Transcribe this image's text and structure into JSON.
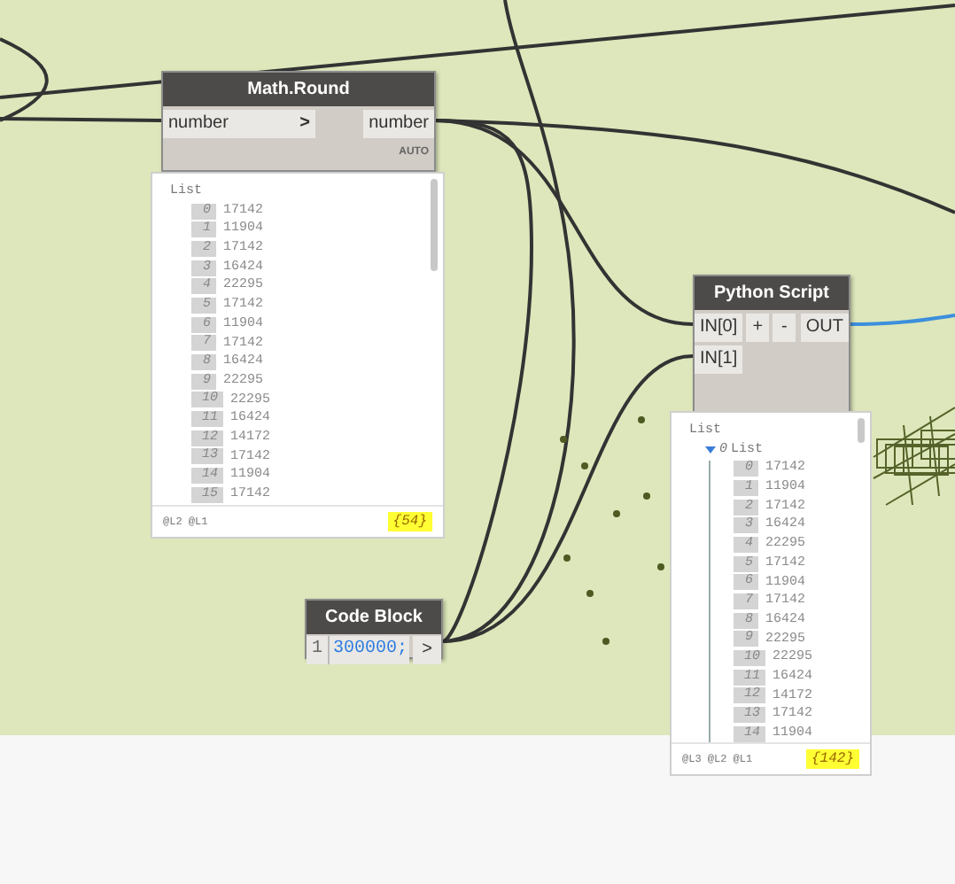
{
  "math_round": {
    "title": "Math.Round",
    "input": "number",
    "input_arrow": ">",
    "output": "number",
    "lacing": "AUTO",
    "preview": {
      "root": "List",
      "items": [
        {
          "index": "0",
          "value": "17142"
        },
        {
          "index": "1",
          "value": "11904"
        },
        {
          "index": "2",
          "value": "17142"
        },
        {
          "index": "3",
          "value": "16424"
        },
        {
          "index": "4",
          "value": "22295"
        },
        {
          "index": "5",
          "value": "17142"
        },
        {
          "index": "6",
          "value": "11904"
        },
        {
          "index": "7",
          "value": "17142"
        },
        {
          "index": "8",
          "value": "16424"
        },
        {
          "index": "9",
          "value": "22295"
        },
        {
          "index": "10",
          "value": "22295"
        },
        {
          "index": "11",
          "value": "16424"
        },
        {
          "index": "12",
          "value": "14172"
        },
        {
          "index": "13",
          "value": "17142"
        },
        {
          "index": "14",
          "value": "11904"
        },
        {
          "index": "15",
          "value": "17142"
        }
      ],
      "levels": "@L2 @L1",
      "count": "{54}",
      "highlighted": true
    }
  },
  "python_script": {
    "title": "Python Script",
    "inputs": [
      "IN[0]",
      "IN[1]"
    ],
    "buttons": [
      "+",
      "-"
    ],
    "output": "OUT",
    "preview": {
      "root": "List",
      "sublist": {
        "index": "0",
        "label": "List",
        "expanded": true
      },
      "items": [
        {
          "index": "0",
          "value": "17142"
        },
        {
          "index": "1",
          "value": "11904"
        },
        {
          "index": "2",
          "value": "17142"
        },
        {
          "index": "3",
          "value": "16424"
        },
        {
          "index": "4",
          "value": "22295"
        },
        {
          "index": "5",
          "value": "17142"
        },
        {
          "index": "6",
          "value": "11904"
        },
        {
          "index": "7",
          "value": "17142"
        },
        {
          "index": "8",
          "value": "16424"
        },
        {
          "index": "9",
          "value": "22295"
        },
        {
          "index": "10",
          "value": "22295"
        },
        {
          "index": "11",
          "value": "16424"
        },
        {
          "index": "12",
          "value": "14172"
        },
        {
          "index": "13",
          "value": "17142"
        },
        {
          "index": "14",
          "value": "11904"
        }
      ],
      "levels": "@L3 @L2 @L1",
      "count": "{142}",
      "highlighted": true
    }
  },
  "code_block": {
    "title": "Code Block",
    "line_number": "1",
    "code": "300000;",
    "output": ">"
  }
}
